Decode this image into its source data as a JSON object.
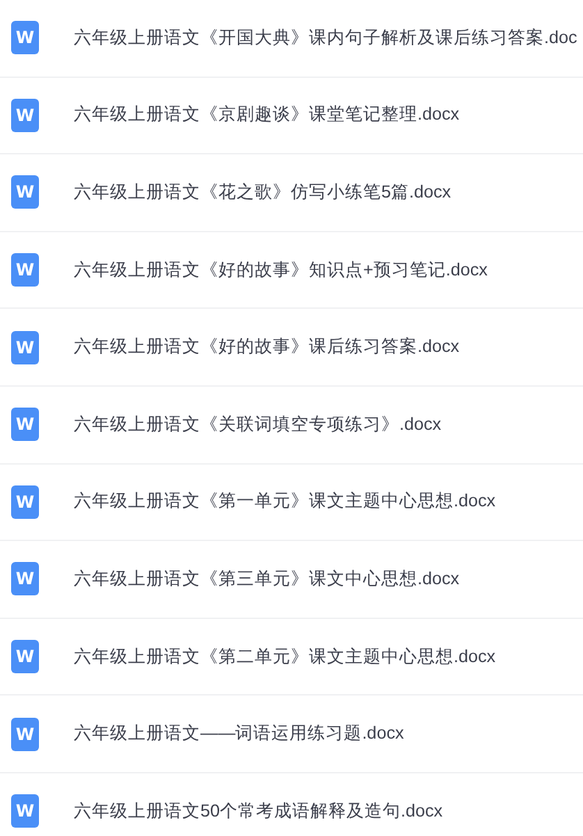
{
  "files": [
    {
      "icon": "W",
      "name": "六年级上册语文《开国大典》课内句子解析及课后练习答案.doc"
    },
    {
      "icon": "W",
      "name": "六年级上册语文《京剧趣谈》课堂笔记整理.docx"
    },
    {
      "icon": "W",
      "name": "六年级上册语文《花之歌》仿写小练笔5篇.docx"
    },
    {
      "icon": "W",
      "name": "六年级上册语文《好的故事》知识点+预习笔记.docx"
    },
    {
      "icon": "W",
      "name": "六年级上册语文《好的故事》课后练习答案.docx"
    },
    {
      "icon": "W",
      "name": "六年级上册语文《关联词填空专项练习》.docx"
    },
    {
      "icon": "W",
      "name": "六年级上册语文《第一单元》课文主题中心思想.docx"
    },
    {
      "icon": "W",
      "name": "六年级上册语文《第三单元》课文中心思想.docx"
    },
    {
      "icon": "W",
      "name": "六年级上册语文《第二单元》课文主题中心思想.docx"
    },
    {
      "icon": "W",
      "name": "六年级上册语文——词语运用练习题.docx"
    },
    {
      "icon": "W",
      "name": "六年级上册语文50个常考成语解释及造句.docx"
    }
  ]
}
